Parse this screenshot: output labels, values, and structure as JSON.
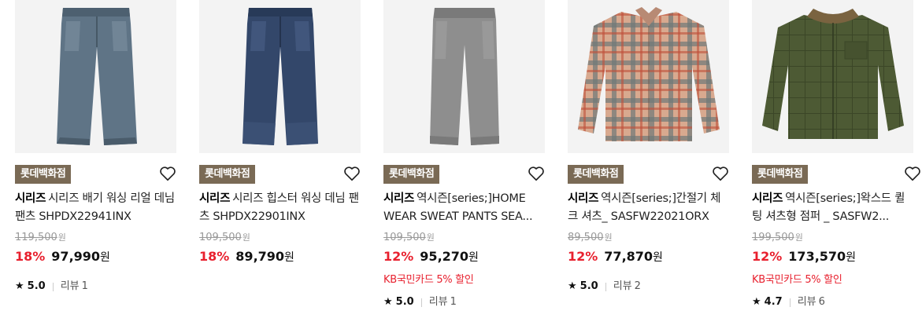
{
  "products": [
    {
      "store": "롯데백화점",
      "brand": "시리즈",
      "title_rest": "시리즈 배기 워싱 리얼 데님 팬츠 SHPDX22941INX",
      "original_price": "119,500",
      "original_unit": "원",
      "discount": "18%",
      "price": "97,990",
      "price_unit": "원",
      "promo": "",
      "rating": "5.0",
      "review_label": "리뷰",
      "review_count": "1",
      "image": "light-wash-jeans"
    },
    {
      "store": "롯데백화점",
      "brand": "시리즈",
      "title_rest": "시리즈 힙스터 워싱 데님 팬츠 SHPDX22901INX",
      "original_price": "109,500",
      "original_unit": "원",
      "discount": "18%",
      "price": "89,790",
      "price_unit": "원",
      "promo": "",
      "rating": "",
      "review_label": "",
      "review_count": "",
      "image": "dark-wash-jeans"
    },
    {
      "store": "롯데백화점",
      "brand": "시리즈",
      "title_rest": "역시즌[series;]HOME WEAR SWEAT PANTS SEA...",
      "original_price": "109,500",
      "original_unit": "원",
      "discount": "12%",
      "price": "95,270",
      "price_unit": "원",
      "promo": "KB국민카드 5% 할인",
      "rating": "5.0",
      "review_label": "리뷰",
      "review_count": "1",
      "image": "grey-sweat-pants"
    },
    {
      "store": "롯데백화점",
      "brand": "시리즈",
      "title_rest": "역시즌[series;]간절기 체크 셔츠_ SASFW22021ORX",
      "original_price": "89,500",
      "original_unit": "원",
      "discount": "12%",
      "price": "77,870",
      "price_unit": "원",
      "promo": "",
      "rating": "5.0",
      "review_label": "리뷰",
      "review_count": "2",
      "image": "check-shirt"
    },
    {
      "store": "롯데백화점",
      "brand": "시리즈",
      "title_rest": "역시즌[series;]왁스드 퀼팅 셔츠형 점퍼 _ SASFW2...",
      "original_price": "199,500",
      "original_unit": "원",
      "discount": "12%",
      "price": "173,570",
      "price_unit": "원",
      "promo": "KB국민카드 5% 할인",
      "rating": "4.7",
      "review_label": "리뷰",
      "review_count": "6",
      "image": "quilted-jacket"
    }
  ],
  "colors": {
    "badge_bg": "#7a6a55",
    "discount": "#e8202e",
    "thumb_bg": "#f3f3f3"
  }
}
